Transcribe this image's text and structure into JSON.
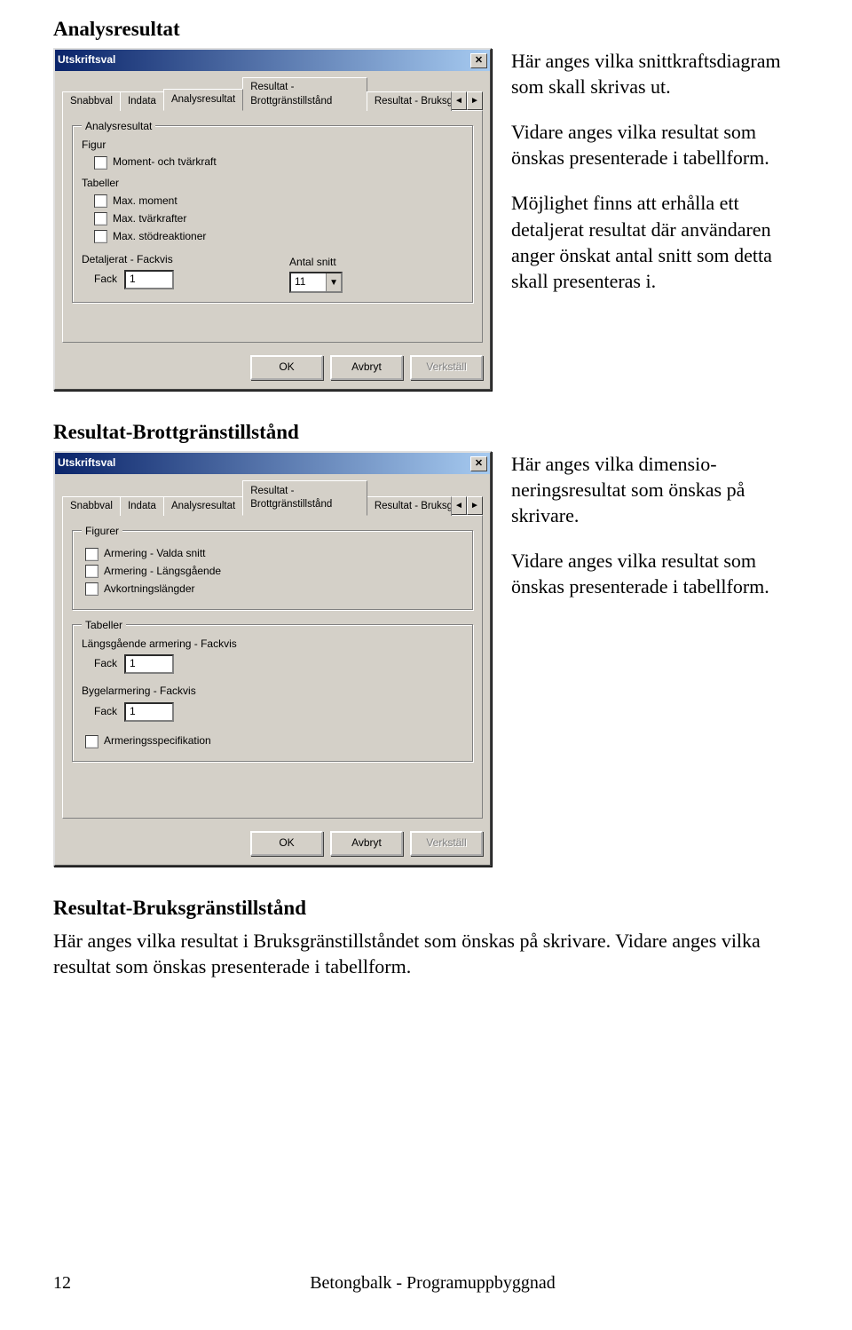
{
  "section1": {
    "heading": "Analysresultat",
    "side": {
      "p1": "Här anges vilka snitt­kraftsdiagram som skall skrivas ut.",
      "p2": "Vidare anges vilka resul­tat som önskas presentera­de i tabellform.",
      "p3": "Möjlighet finns att erhålla ett detaljerat resultat där användaren anger önskat antal snitt som detta skall presenteras i."
    },
    "dialog": {
      "title": "Utskriftsval",
      "close": "✕",
      "tabs": [
        "Snabbval",
        "Indata",
        "Analysresultat",
        "Resultat - Brottgränstillstånd",
        "Resultat - Bruksgr"
      ],
      "activeTabIndex": 2,
      "group_label": "Analysresultat",
      "figur_label": "Figur",
      "chk_figur1": "Moment- och tvärkraft",
      "tabeller_label": "Tabeller",
      "chk_tab1": "Max. moment",
      "chk_tab2": "Max. tvärkrafter",
      "chk_tab3": "Max. stödreaktioner",
      "det_label": "Detaljerat - Fackvis",
      "fack_label": "Fack",
      "fack_value": "1",
      "antal_label": "Antal snitt",
      "antal_value": "11",
      "buttons": {
        "ok": "OK",
        "cancel": "Avbryt",
        "apply": "Verkställ"
      }
    }
  },
  "section2": {
    "heading": "Resultat-Brottgränstillstånd",
    "side": {
      "p1": "Här anges vilka dimensio­neringsresultat som öns­kas på skrivare.",
      "p2": "Vidare anges vilka resultat som önskas presenterade i tabellform."
    },
    "dialog": {
      "title": "Utskriftsval",
      "close": "✕",
      "tabs": [
        "Snabbval",
        "Indata",
        "Analysresultat",
        "Resultat - Brottgränstillstånd",
        "Resultat - Bruksgr"
      ],
      "activeTabIndex": 3,
      "group_fig_label": "Figurer",
      "chk_f1": "Armering - Valda snitt",
      "chk_f2": "Armering - Längsgående",
      "chk_f3": "Avkortningslängder",
      "group_tab_label": "Tabeller",
      "tab1_label": "Längsgående armering - Fackvis",
      "tab1_fack_label": "Fack",
      "tab1_fack_value": "1",
      "tab2_label": "Bygelarmering - Fackvis",
      "tab2_fack_label": "Fack",
      "tab2_fack_value": "1",
      "chk_spec": "Armeringsspecifikation",
      "buttons": {
        "ok": "OK",
        "cancel": "Avbryt",
        "apply": "Verkställ"
      }
    }
  },
  "section3": {
    "heading": "Resultat-Bruksgränstillstånd",
    "p1": "Här anges vilka resultat i Bruksgränstillståndet som önskas på skrivare. Vidare anges vilka resultat som önskas presenterade i tabellform."
  },
  "footer": {
    "pagenum": "12",
    "doctitle": "Betongbalk - Programuppbyggnad"
  },
  "glyphs": {
    "left": "◄",
    "right": "►",
    "down": "▼"
  }
}
